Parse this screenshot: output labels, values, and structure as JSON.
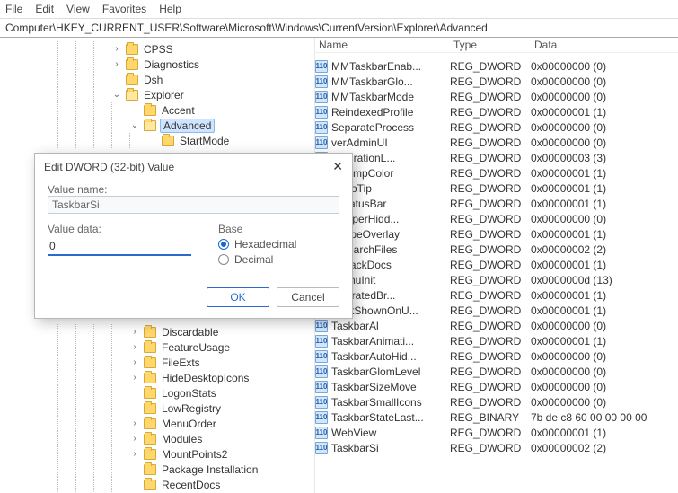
{
  "menu": {
    "file": "File",
    "edit": "Edit",
    "view": "View",
    "favorites": "Favorites",
    "help": "Help"
  },
  "address": "Computer\\HKEY_CURRENT_USER\\Software\\Microsoft\\Windows\\CurrentVersion\\Explorer\\Advanced",
  "tree_top": [
    {
      "depth": 6,
      "exp": ">",
      "icon": "folder",
      "label": "CPSS"
    },
    {
      "depth": 6,
      "exp": ">",
      "icon": "folder",
      "label": "Diagnostics"
    },
    {
      "depth": 6,
      "exp": "",
      "icon": "folder",
      "label": "Dsh"
    },
    {
      "depth": 6,
      "exp": "v",
      "icon": "folder",
      "label": "Explorer",
      "open": true
    },
    {
      "depth": 7,
      "exp": "",
      "icon": "folder",
      "label": "Accent"
    },
    {
      "depth": 7,
      "exp": "v",
      "icon": "folder",
      "label": "Advanced",
      "open": true,
      "selected": true
    },
    {
      "depth": 8,
      "exp": "",
      "icon": "folder",
      "label": "StartMode"
    }
  ],
  "tree_bottom": [
    {
      "depth": 7,
      "exp": ">",
      "icon": "folder",
      "label": "Discardable"
    },
    {
      "depth": 7,
      "exp": ">",
      "icon": "folder",
      "label": "FeatureUsage"
    },
    {
      "depth": 7,
      "exp": ">",
      "icon": "folder",
      "label": "FileExts"
    },
    {
      "depth": 7,
      "exp": ">",
      "icon": "folder",
      "label": "HideDesktopIcons"
    },
    {
      "depth": 7,
      "exp": "",
      "icon": "folder",
      "label": "LogonStats"
    },
    {
      "depth": 7,
      "exp": "",
      "icon": "folder",
      "label": "LowRegistry"
    },
    {
      "depth": 7,
      "exp": ">",
      "icon": "folder",
      "label": "MenuOrder"
    },
    {
      "depth": 7,
      "exp": ">",
      "icon": "folder",
      "label": "Modules"
    },
    {
      "depth": 7,
      "exp": ">",
      "icon": "folder",
      "label": "MountPoints2"
    },
    {
      "depth": 7,
      "exp": "",
      "icon": "folder",
      "label": "Package Installation"
    },
    {
      "depth": 7,
      "exp": "",
      "icon": "folder",
      "label": "RecentDocs"
    }
  ],
  "columns": {
    "name": "Name",
    "type": "Type",
    "data": "Data"
  },
  "entries": [
    {
      "name": "MMTaskbarEnab...",
      "type": "REG_DWORD",
      "data": "0x00000000 (0)"
    },
    {
      "name": "MMTaskbarGlo...",
      "type": "REG_DWORD",
      "data": "0x00000000 (0)"
    },
    {
      "name": "MMTaskbarMode",
      "type": "REG_DWORD",
      "data": "0x00000000 (0)"
    },
    {
      "name": "ReindexedProfile",
      "type": "REG_DWORD",
      "data": "0x00000001 (1)"
    },
    {
      "name": "SeparateProcess",
      "type": "REG_DWORD",
      "data": "0x00000000 (0)"
    },
    {
      "name": "ServerAdminUI",
      "type": "REG_DWORD",
      "data": "0x00000000 (0)",
      "clip": "verAdminUI"
    },
    {
      "name": "llMigrationL...",
      "type": "REG_DWORD",
      "data": "0x00000003 (3)",
      "clip": "llMigrationL..."
    },
    {
      "name": "wCompColor",
      "type": "REG_DWORD",
      "data": "0x00000001 (1)",
      "clip": "wCompColor"
    },
    {
      "name": "wInfoTip",
      "type": "REG_DWORD",
      "data": "0x00000001 (1)",
      "clip": "wInfoTip"
    },
    {
      "name": "wStatusBar",
      "type": "REG_DWORD",
      "data": "0x00000001 (1)",
      "clip": "wStatusBar"
    },
    {
      "name": "wSuperHidd...",
      "type": "REG_DWORD",
      "data": "0x00000000 (0)",
      "clip": "wSuperHidd..."
    },
    {
      "name": "wTypeOverlay",
      "type": "REG_DWORD",
      "data": "0x00000001 (1)",
      "clip": "wTypeOverlay"
    },
    {
      "name": "t_SearchFiles",
      "type": "REG_DWORD",
      "data": "0x00000002 (2)",
      "clip": "t_SearchFiles"
    },
    {
      "name": "t_TrackDocs",
      "type": "REG_DWORD",
      "data": "0x00000001 (1)",
      "clip": "t_TrackDocs"
    },
    {
      "name": "tMenuInit",
      "type": "REG_DWORD",
      "data": "0x0000000d (13)",
      "clip": "tMenuInit"
    },
    {
      "name": "tMigratedBr...",
      "type": "REG_DWORD",
      "data": "0x00000001 (1)",
      "clip": "tMigratedBr..."
    },
    {
      "name": "StartShownOnU...",
      "type": "REG_DWORD",
      "data": "0x00000001 (1)"
    },
    {
      "name": "TaskbarAl",
      "type": "REG_DWORD",
      "data": "0x00000000 (0)"
    },
    {
      "name": "TaskbarAnimati...",
      "type": "REG_DWORD",
      "data": "0x00000001 (1)"
    },
    {
      "name": "TaskbarAutoHid...",
      "type": "REG_DWORD",
      "data": "0x00000000 (0)"
    },
    {
      "name": "TaskbarGlomLevel",
      "type": "REG_DWORD",
      "data": "0x00000000 (0)"
    },
    {
      "name": "TaskbarSizeMove",
      "type": "REG_DWORD",
      "data": "0x00000000 (0)"
    },
    {
      "name": "TaskbarSmallIcons",
      "type": "REG_DWORD",
      "data": "0x00000000 (0)"
    },
    {
      "name": "TaskbarStateLast...",
      "type": "REG_BINARY",
      "data": "7b de c8 60 00 00 00 00"
    },
    {
      "name": "WebView",
      "type": "REG_DWORD",
      "data": "0x00000001 (1)"
    },
    {
      "name": "TaskbarSi",
      "type": "REG_DWORD",
      "data": "0x00000002 (2)"
    }
  ],
  "dialog": {
    "title": "Edit DWORD (32-bit) Value",
    "value_name_label": "Value name:",
    "value_name": "TaskbarSi",
    "value_data_label": "Value data:",
    "value_data": "0",
    "base_label": "Base",
    "hex": "Hexadecimal",
    "dec": "Decimal",
    "ok": "OK",
    "cancel": "Cancel"
  }
}
